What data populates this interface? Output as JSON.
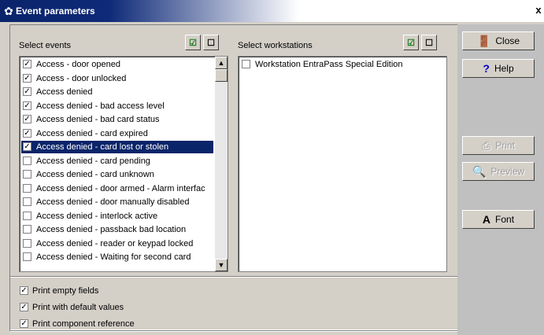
{
  "window": {
    "title": "Event parameters",
    "close_glyph": "x"
  },
  "events": {
    "label": "Select events",
    "items": [
      {
        "label": "Access - door opened",
        "checked": true,
        "selected": false
      },
      {
        "label": "Access - door unlocked",
        "checked": true,
        "selected": false
      },
      {
        "label": "Access denied",
        "checked": true,
        "selected": false
      },
      {
        "label": "Access denied - bad access level",
        "checked": true,
        "selected": false
      },
      {
        "label": "Access denied - bad card status",
        "checked": true,
        "selected": false
      },
      {
        "label": "Access denied - card expired",
        "checked": true,
        "selected": false
      },
      {
        "label": "Access denied - card lost or stolen",
        "checked": true,
        "selected": true
      },
      {
        "label": "Access denied - card pending",
        "checked": false,
        "selected": false
      },
      {
        "label": "Access denied - card unknown",
        "checked": false,
        "selected": false
      },
      {
        "label": "Access denied - door armed - Alarm interfac",
        "checked": false,
        "selected": false
      },
      {
        "label": "Access denied - door manually disabled",
        "checked": false,
        "selected": false
      },
      {
        "label": "Access denied - interlock active",
        "checked": false,
        "selected": false
      },
      {
        "label": "Access denied - passback bad location",
        "checked": false,
        "selected": false
      },
      {
        "label": "Access denied - reader or keypad locked",
        "checked": false,
        "selected": false
      },
      {
        "label": "Access denied - Waiting for second card",
        "checked": false,
        "selected": false
      }
    ]
  },
  "workstations": {
    "label": "Select workstations",
    "items": [
      {
        "label": "Workstation EntraPass Special Edition",
        "checked": false
      }
    ]
  },
  "options": [
    {
      "label": "Print empty fields",
      "checked": true
    },
    {
      "label": "Print with default values",
      "checked": true
    },
    {
      "label": "Print component reference",
      "checked": true
    }
  ],
  "buttons": {
    "close": "Close",
    "help": "Help",
    "print": "Print",
    "preview": "Preview",
    "font": "Font"
  }
}
